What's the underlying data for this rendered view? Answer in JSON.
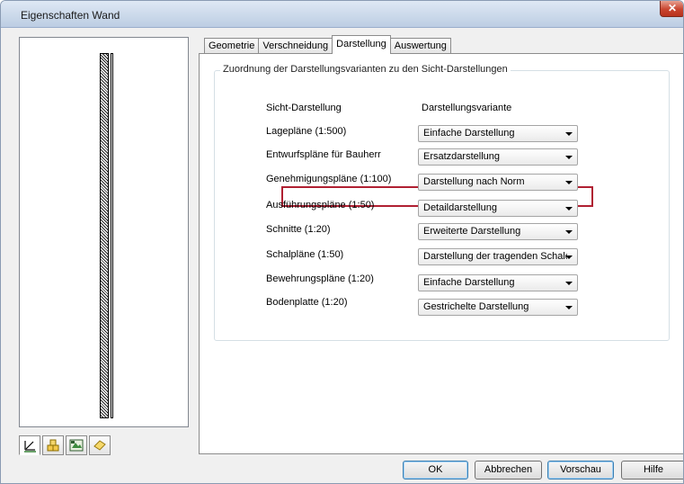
{
  "window": {
    "title": "Eigenschaften Wand",
    "close_label": "✕"
  },
  "view_tabs": [
    {
      "name": "wall-view-icon"
    },
    {
      "name": "materials-icon"
    },
    {
      "name": "layers-icon"
    },
    {
      "name": "surface-icon"
    }
  ],
  "tabs": [
    {
      "label": "Geometrie",
      "active": false
    },
    {
      "label": "Verschneidung",
      "active": false
    },
    {
      "label": "Darstellung",
      "active": true
    },
    {
      "label": "Auswertung",
      "active": false
    }
  ],
  "group": {
    "label": "Zuordnung der Darstellungsvarianten zu den Sicht-Darstellungen"
  },
  "columns": {
    "left": "Sicht-Darstellung",
    "right": "Darstellungsvariante"
  },
  "rows": [
    {
      "label": "Lagepläne (1:500)",
      "value": "Einfache Darstellung"
    },
    {
      "label": "Entwurfspläne für Bauherr",
      "value": "Ersatzdarstellung"
    },
    {
      "label": "Genehmigungspläne (1:100)",
      "value": "Darstellung nach Norm",
      "highlighted": true
    },
    {
      "label": "Ausführungspläne (1:50)",
      "value": "Detaildarstellung"
    },
    {
      "label": "Schnitte (1:20)",
      "value": "Erweiterte Darstellung"
    },
    {
      "label": "Schalpläne (1:50)",
      "value": "Darstellung der tragenden Schale"
    },
    {
      "label": "Bewehrungspläne (1:20)",
      "value": "Einfache Darstellung"
    },
    {
      "label": "Bodenplatte (1:20)",
      "value": "Gestrichelte Darstellung"
    }
  ],
  "buttons": {
    "ok": "OK",
    "cancel": "Abbrechen",
    "preview": "Vorschau",
    "help": "Hilfe"
  },
  "colors": {
    "highlight": "#b02032",
    "default_button_border": "#3c7fb1"
  }
}
